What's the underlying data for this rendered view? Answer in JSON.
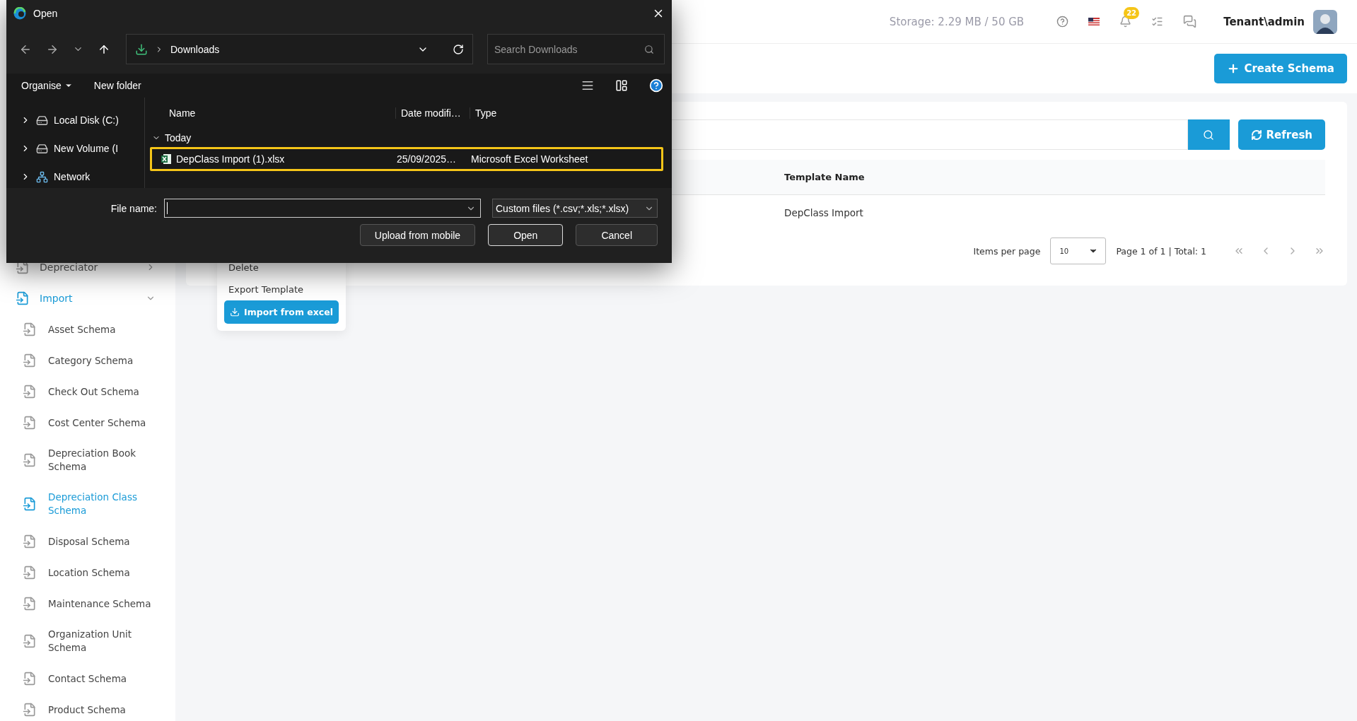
{
  "header": {
    "storage": "Storage: 2.29 MB / 50 GB",
    "notification_count": "22",
    "user": "Tenant\\admin"
  },
  "page_toolbar": {
    "create_button": "Create Schema"
  },
  "search": {
    "refresh_button": "Refresh"
  },
  "table": {
    "columns": [
      "Template Name"
    ],
    "rows": [
      [
        "DepClass Import"
      ]
    ]
  },
  "pagination": {
    "items_per_page_label": "Items per page",
    "page_size": "10",
    "summary": "Page 1 of 1 | Total: 1"
  },
  "context_menu": {
    "items": [
      {
        "label": "Delete",
        "kind": "item"
      },
      {
        "label": "Export Template",
        "kind": "item"
      },
      {
        "label": "Import from excel",
        "kind": "button"
      }
    ]
  },
  "sidebar": {
    "items": [
      {
        "label": "Depreciator",
        "expanded": false,
        "selected": false
      },
      {
        "label": "Import",
        "expanded": true,
        "selected": true,
        "children": [
          {
            "label": "Asset Schema",
            "selected": false
          },
          {
            "label": "Category Schema",
            "selected": false
          },
          {
            "label": "Check Out Schema",
            "selected": false
          },
          {
            "label": "Cost Center Schema",
            "selected": false
          },
          {
            "label": "Depreciation Book Schema",
            "selected": false
          },
          {
            "label": "Depreciation Class Schema",
            "selected": true
          },
          {
            "label": "Disposal Schema",
            "selected": false
          },
          {
            "label": "Location Schema",
            "selected": false
          },
          {
            "label": "Maintenance Schema",
            "selected": false
          },
          {
            "label": "Organization Unit Schema",
            "selected": false
          },
          {
            "label": "Contact Schema",
            "selected": false
          },
          {
            "label": "Product Schema",
            "selected": false
          }
        ]
      }
    ]
  },
  "dialog": {
    "title": "Open",
    "path": "Downloads",
    "search": {
      "placeholder": "Search Downloads"
    },
    "toolbar": {
      "organise": "Organise",
      "new_folder": "New folder"
    },
    "tree": [
      {
        "label": "Local Disk (C:)",
        "kind": "drive"
      },
      {
        "label": "New Volume (I",
        "kind": "drive"
      },
      {
        "label": "Network",
        "kind": "network"
      }
    ],
    "columns": [
      "Name",
      "Date modifi…",
      "Type"
    ],
    "groups": [
      {
        "label": "Today",
        "expanded": true,
        "files": [
          {
            "name": "DepClass Import (1).xlsx",
            "date": "25/09/2025…",
            "type": "Microsoft Excel Worksheet",
            "selected": true
          }
        ]
      }
    ],
    "file_name_label": "File name:",
    "file_type": "Custom files (*.csv;*.xls;*.xlsx)",
    "buttons": [
      {
        "label": "Upload from mobile",
        "kind": "secondary"
      },
      {
        "label": "Open",
        "kind": "primary"
      },
      {
        "label": "Cancel",
        "kind": "secondary"
      }
    ]
  }
}
